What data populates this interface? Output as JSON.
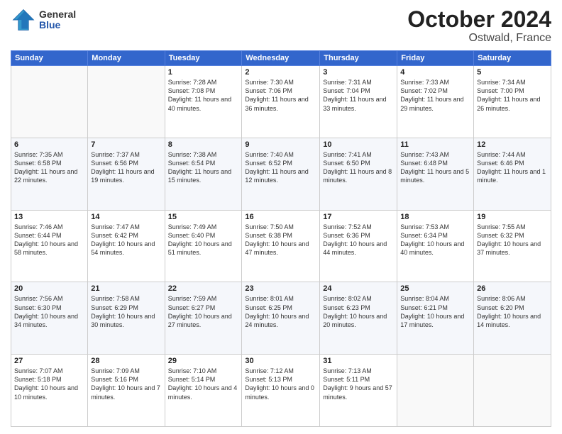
{
  "logo": {
    "general": "General",
    "blue": "Blue"
  },
  "header": {
    "month": "October 2024",
    "location": "Ostwald, France"
  },
  "days_of_week": [
    "Sunday",
    "Monday",
    "Tuesday",
    "Wednesday",
    "Thursday",
    "Friday",
    "Saturday"
  ],
  "weeks": [
    [
      {
        "day": "",
        "content": ""
      },
      {
        "day": "",
        "content": ""
      },
      {
        "day": "1",
        "content": "Sunrise: 7:28 AM\nSunset: 7:08 PM\nDaylight: 11 hours and 40 minutes."
      },
      {
        "day": "2",
        "content": "Sunrise: 7:30 AM\nSunset: 7:06 PM\nDaylight: 11 hours and 36 minutes."
      },
      {
        "day": "3",
        "content": "Sunrise: 7:31 AM\nSunset: 7:04 PM\nDaylight: 11 hours and 33 minutes."
      },
      {
        "day": "4",
        "content": "Sunrise: 7:33 AM\nSunset: 7:02 PM\nDaylight: 11 hours and 29 minutes."
      },
      {
        "day": "5",
        "content": "Sunrise: 7:34 AM\nSunset: 7:00 PM\nDaylight: 11 hours and 26 minutes."
      }
    ],
    [
      {
        "day": "6",
        "content": "Sunrise: 7:35 AM\nSunset: 6:58 PM\nDaylight: 11 hours and 22 minutes."
      },
      {
        "day": "7",
        "content": "Sunrise: 7:37 AM\nSunset: 6:56 PM\nDaylight: 11 hours and 19 minutes."
      },
      {
        "day": "8",
        "content": "Sunrise: 7:38 AM\nSunset: 6:54 PM\nDaylight: 11 hours and 15 minutes."
      },
      {
        "day": "9",
        "content": "Sunrise: 7:40 AM\nSunset: 6:52 PM\nDaylight: 11 hours and 12 minutes."
      },
      {
        "day": "10",
        "content": "Sunrise: 7:41 AM\nSunset: 6:50 PM\nDaylight: 11 hours and 8 minutes."
      },
      {
        "day": "11",
        "content": "Sunrise: 7:43 AM\nSunset: 6:48 PM\nDaylight: 11 hours and 5 minutes."
      },
      {
        "day": "12",
        "content": "Sunrise: 7:44 AM\nSunset: 6:46 PM\nDaylight: 11 hours and 1 minute."
      }
    ],
    [
      {
        "day": "13",
        "content": "Sunrise: 7:46 AM\nSunset: 6:44 PM\nDaylight: 10 hours and 58 minutes."
      },
      {
        "day": "14",
        "content": "Sunrise: 7:47 AM\nSunset: 6:42 PM\nDaylight: 10 hours and 54 minutes."
      },
      {
        "day": "15",
        "content": "Sunrise: 7:49 AM\nSunset: 6:40 PM\nDaylight: 10 hours and 51 minutes."
      },
      {
        "day": "16",
        "content": "Sunrise: 7:50 AM\nSunset: 6:38 PM\nDaylight: 10 hours and 47 minutes."
      },
      {
        "day": "17",
        "content": "Sunrise: 7:52 AM\nSunset: 6:36 PM\nDaylight: 10 hours and 44 minutes."
      },
      {
        "day": "18",
        "content": "Sunrise: 7:53 AM\nSunset: 6:34 PM\nDaylight: 10 hours and 40 minutes."
      },
      {
        "day": "19",
        "content": "Sunrise: 7:55 AM\nSunset: 6:32 PM\nDaylight: 10 hours and 37 minutes."
      }
    ],
    [
      {
        "day": "20",
        "content": "Sunrise: 7:56 AM\nSunset: 6:30 PM\nDaylight: 10 hours and 34 minutes."
      },
      {
        "day": "21",
        "content": "Sunrise: 7:58 AM\nSunset: 6:29 PM\nDaylight: 10 hours and 30 minutes."
      },
      {
        "day": "22",
        "content": "Sunrise: 7:59 AM\nSunset: 6:27 PM\nDaylight: 10 hours and 27 minutes."
      },
      {
        "day": "23",
        "content": "Sunrise: 8:01 AM\nSunset: 6:25 PM\nDaylight: 10 hours and 24 minutes."
      },
      {
        "day": "24",
        "content": "Sunrise: 8:02 AM\nSunset: 6:23 PM\nDaylight: 10 hours and 20 minutes."
      },
      {
        "day": "25",
        "content": "Sunrise: 8:04 AM\nSunset: 6:21 PM\nDaylight: 10 hours and 17 minutes."
      },
      {
        "day": "26",
        "content": "Sunrise: 8:06 AM\nSunset: 6:20 PM\nDaylight: 10 hours and 14 minutes."
      }
    ],
    [
      {
        "day": "27",
        "content": "Sunrise: 7:07 AM\nSunset: 5:18 PM\nDaylight: 10 hours and 10 minutes."
      },
      {
        "day": "28",
        "content": "Sunrise: 7:09 AM\nSunset: 5:16 PM\nDaylight: 10 hours and 7 minutes."
      },
      {
        "day": "29",
        "content": "Sunrise: 7:10 AM\nSunset: 5:14 PM\nDaylight: 10 hours and 4 minutes."
      },
      {
        "day": "30",
        "content": "Sunrise: 7:12 AM\nSunset: 5:13 PM\nDaylight: 10 hours and 0 minutes."
      },
      {
        "day": "31",
        "content": "Sunrise: 7:13 AM\nSunset: 5:11 PM\nDaylight: 9 hours and 57 minutes."
      },
      {
        "day": "",
        "content": ""
      },
      {
        "day": "",
        "content": ""
      }
    ]
  ]
}
